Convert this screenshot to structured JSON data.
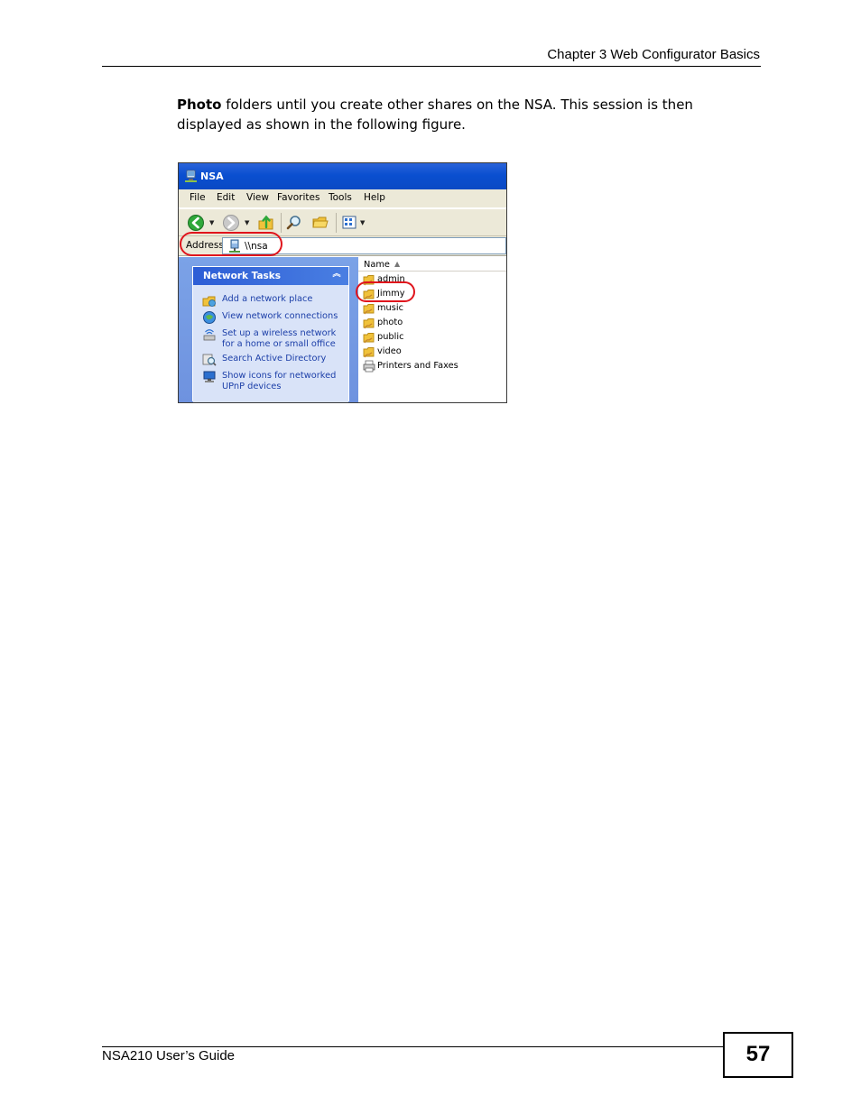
{
  "header": {
    "chapter_title": "Chapter 3 Web Configurator Basics"
  },
  "body": {
    "bold_lead": "Photo",
    "paragraph_rest": " folders until you create other shares on the NSA. This session is then displayed as shown in the following figure."
  },
  "window": {
    "title": "NSA",
    "menu": [
      "File",
      "Edit",
      "View",
      "Favorites",
      "Tools",
      "Help"
    ],
    "address": {
      "label": "Address",
      "value": "\\\\nsa"
    },
    "network_tasks": {
      "header": "Network Tasks",
      "items": [
        {
          "label": "Add a network place",
          "icon": "network-place-icon"
        },
        {
          "label": "View network connections",
          "icon": "network-connections-icon"
        },
        {
          "label": "Set up a wireless network for a home or small office",
          "icon": "wireless-setup-icon"
        },
        {
          "label": "Search Active Directory",
          "icon": "directory-search-icon"
        },
        {
          "label": "Show icons for networked UPnP devices",
          "icon": "upnp-devices-icon"
        }
      ]
    },
    "file_list": {
      "column_header": "Name",
      "items": [
        "admin",
        "Jimmy",
        "music",
        "photo",
        "public",
        "video",
        "Printers and Faxes"
      ]
    }
  },
  "footer": {
    "guide_title": "NSA210 User’s Guide",
    "page_number": "57"
  },
  "colors": {
    "highlight": "#e0141c",
    "titlebar": "#0a4fd0",
    "task_link": "#1c3fa8"
  }
}
